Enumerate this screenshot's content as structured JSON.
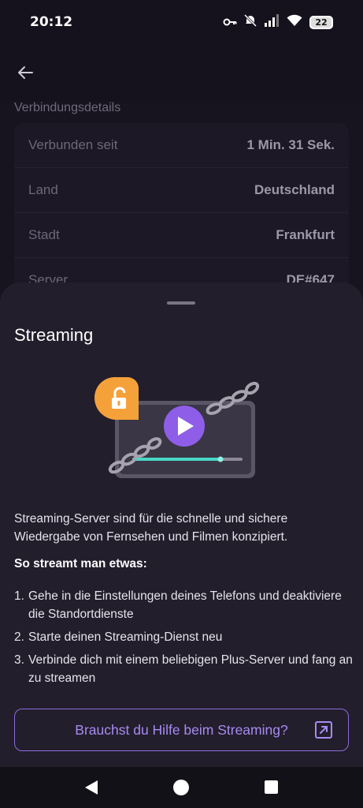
{
  "status_bar": {
    "time": "20:12",
    "battery": "22",
    "icons": [
      "key-icon",
      "mute-icon",
      "signal-icon",
      "wifi-icon",
      "battery-icon"
    ]
  },
  "app_bar": {
    "back_icon": "arrow-left-icon"
  },
  "connection": {
    "section_label": "Verbindungsdetails",
    "rows": [
      {
        "label": "Verbunden seit",
        "value": "1 Min. 31 Sek."
      },
      {
        "label": "Land",
        "value": "Deutschland"
      },
      {
        "label": "Stadt",
        "value": "Frankfurt"
      },
      {
        "label": "Server",
        "value": "DE#647"
      }
    ]
  },
  "sheet": {
    "title": "Streaming",
    "description": "Streaming-Server sind für die schnelle und sichere Wiedergabe von Fernsehen und Filmen konzipiert.",
    "howto_title": "So streamt man etwas:",
    "steps": [
      {
        "num": "1.",
        "text": "Gehe in die Einstellungen deines Telefons und deaktiviere die Standortdienste"
      },
      {
        "num": "2.",
        "text": "Starte deinen Streaming-Dienst neu"
      },
      {
        "num": "3.",
        "text": "Verbinde dich mit einem beliebigen Plus-Server und fang an zu streamen"
      }
    ],
    "help_button": "Brauchst du Hilfe beim Streaming?"
  },
  "colors": {
    "accent": "#a88af3",
    "accent_border": "#8b6ce0",
    "sheet_bg": "#221e2b",
    "lock_orange": "#f5a13a",
    "play_purple": "#8f5ee8"
  }
}
